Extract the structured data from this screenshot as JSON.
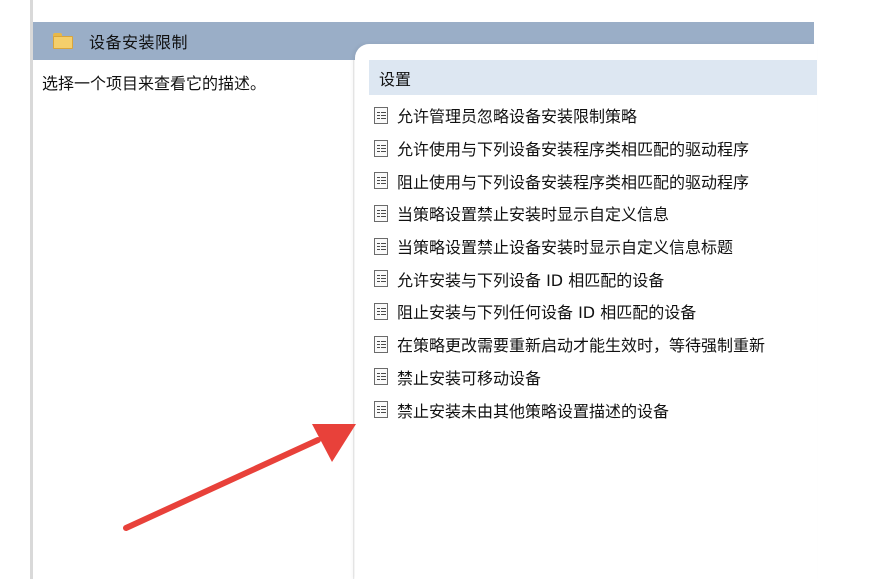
{
  "header": {
    "title": "设备安装限制",
    "icon": "folder-icon"
  },
  "description_pane": {
    "text": "选择一个项目来查看它的描述。"
  },
  "settings": {
    "column_header": "设置",
    "items": [
      {
        "label": "允许管理员忽略设备安装限制策略",
        "icon": "policy-setting-icon"
      },
      {
        "label": "允许使用与下列设备安装程序类相匹配的驱动程序",
        "icon": "policy-setting-icon"
      },
      {
        "label": "阻止使用与下列设备安装程序类相匹配的驱动程序",
        "icon": "policy-setting-icon"
      },
      {
        "label": "当策略设置禁止安装时显示自定义信息",
        "icon": "policy-setting-icon"
      },
      {
        "label": "当策略设置禁止设备安装时显示自定义信息标题",
        "icon": "policy-setting-icon"
      },
      {
        "label": "允许安装与下列设备 ID 相匹配的设备",
        "icon": "policy-setting-icon"
      },
      {
        "label": "阻止安装与下列任何设备 ID 相匹配的设备",
        "icon": "policy-setting-icon"
      },
      {
        "label": "在策略更改需要重新启动才能生效时，等待强制重新",
        "icon": "policy-setting-icon"
      },
      {
        "label": "禁止安装可移动设备",
        "icon": "policy-setting-icon"
      },
      {
        "label": "禁止安装未由其他策略设置描述的设备",
        "icon": "policy-setting-icon"
      }
    ]
  },
  "annotation": {
    "color": "#e8413a",
    "icon": "red-arrow-icon"
  }
}
